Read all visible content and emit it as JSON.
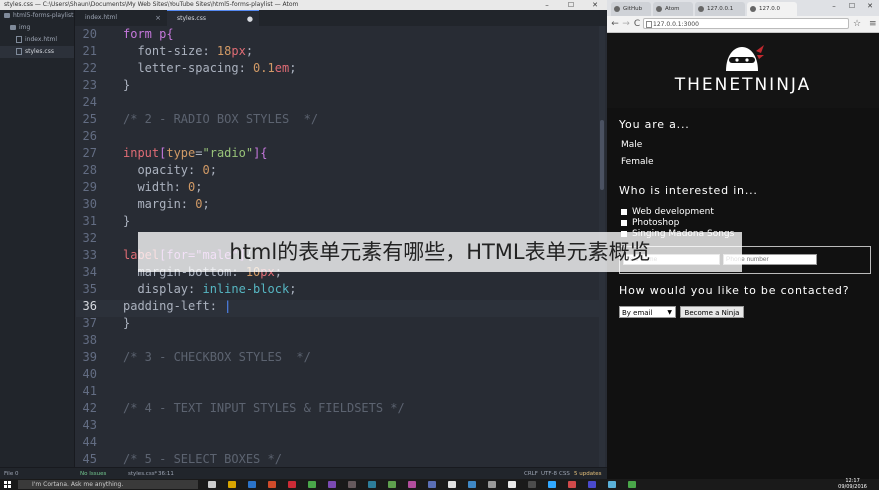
{
  "atom": {
    "title": "styles.css — C:\\Users\\Shaun\\Documents\\My Web Sites\\YouTube Sites\\html5-forms-playlist — Atom",
    "window_controls": [
      "–",
      "☐",
      "✕"
    ],
    "tree": {
      "root": "html5-forms-playlist",
      "items": [
        {
          "label": "img",
          "type": "folder"
        },
        {
          "label": "index.html",
          "type": "file"
        },
        {
          "label": "styles.css",
          "type": "file",
          "selected": true
        }
      ]
    },
    "tabs": [
      {
        "label": "index.html",
        "active": false
      },
      {
        "label": "styles.css",
        "active": true
      }
    ],
    "lines": [
      {
        "n": "20",
        "tokens": [
          [
            "form p{",
            "#c678dd"
          ]
        ]
      },
      {
        "n": "21",
        "tokens": [
          [
            "  font-size: ",
            "#abb2bf"
          ],
          [
            "18",
            "#d19a66"
          ],
          [
            "px",
            "#e06c75"
          ],
          [
            ";",
            "#abb2bf"
          ]
        ]
      },
      {
        "n": "22",
        "tokens": [
          [
            "  letter-spacing: ",
            "#abb2bf"
          ],
          [
            "0.1",
            "#d19a66"
          ],
          [
            "em",
            "#e06c75"
          ],
          [
            ";",
            "#abb2bf"
          ]
        ]
      },
      {
        "n": "23",
        "tokens": [
          [
            "}",
            "#abb2bf"
          ]
        ]
      },
      {
        "n": "24",
        "tokens": []
      },
      {
        "n": "25",
        "tokens": [
          [
            "/* 2 - RADIO BOX STYLES  */",
            "#5c6370"
          ]
        ]
      },
      {
        "n": "26",
        "tokens": []
      },
      {
        "n": "27",
        "tokens": [
          [
            "input",
            "#e06c75"
          ],
          [
            "[",
            "#c678dd"
          ],
          [
            "type",
            "#d19a66"
          ],
          [
            "=",
            "#abb2bf"
          ],
          [
            "\"radio\"",
            "#98c379"
          ],
          [
            "]{",
            "#c678dd"
          ]
        ]
      },
      {
        "n": "28",
        "tokens": [
          [
            "  opacity: ",
            "#abb2bf"
          ],
          [
            "0",
            "#d19a66"
          ],
          [
            ";",
            "#abb2bf"
          ]
        ]
      },
      {
        "n": "29",
        "tokens": [
          [
            "  width: ",
            "#abb2bf"
          ],
          [
            "0",
            "#d19a66"
          ],
          [
            ";",
            "#abb2bf"
          ]
        ]
      },
      {
        "n": "30",
        "tokens": [
          [
            "  margin: ",
            "#abb2bf"
          ],
          [
            "0",
            "#d19a66"
          ],
          [
            ";",
            "#abb2bf"
          ]
        ]
      },
      {
        "n": "31",
        "tokens": [
          [
            "}",
            "#abb2bf"
          ]
        ]
      },
      {
        "n": "32",
        "tokens": []
      },
      {
        "n": "33",
        "tokens": [
          [
            "label",
            "#e06c75"
          ],
          [
            "[for=\"male\"]",
            "#c678dd"
          ],
          [
            "{",
            "#abb2bf"
          ]
        ]
      },
      {
        "n": "34",
        "tokens": [
          [
            "  margin-bottom: ",
            "#abb2bf"
          ],
          [
            "10",
            "#d19a66"
          ],
          [
            "px",
            "#e06c75"
          ],
          [
            ";",
            "#abb2bf"
          ]
        ]
      },
      {
        "n": "35",
        "tokens": [
          [
            "  display: ",
            "#abb2bf"
          ],
          [
            "inline-block",
            "#56b6c2"
          ],
          [
            ";",
            "#abb2bf"
          ]
        ]
      },
      {
        "n": "36",
        "tokens": [
          [
            "padding-left: ",
            "#abb2bf"
          ],
          [
            "|",
            "#528bff"
          ]
        ],
        "current": true
      },
      {
        "n": "37",
        "tokens": [
          [
            "}",
            "#abb2bf"
          ]
        ]
      },
      {
        "n": "38",
        "tokens": []
      },
      {
        "n": "39",
        "tokens": [
          [
            "/* 3 - CHECKBOX STYLES  */",
            "#5c6370"
          ]
        ]
      },
      {
        "n": "40",
        "tokens": []
      },
      {
        "n": "41",
        "tokens": []
      },
      {
        "n": "42",
        "tokens": [
          [
            "/* 4 - TEXT INPUT STYLES & FIELDSETS */",
            "#5c6370"
          ]
        ]
      },
      {
        "n": "43",
        "tokens": []
      },
      {
        "n": "44",
        "tokens": []
      },
      {
        "n": "45",
        "tokens": [
          [
            "/* 5 - SELECT BOXES */",
            "#5c6370"
          ]
        ]
      }
    ],
    "status": {
      "left_file": "File 0",
      "issues": "No Issues",
      "path": "styles.css*",
      "pos": "36:11",
      "eol": "CRLF",
      "enc": "UTF-8",
      "grammar": "CSS",
      "updates": "5 updates"
    }
  },
  "chrome": {
    "tabs": [
      {
        "label": "GitHub",
        "active": false
      },
      {
        "label": "Atom",
        "active": false
      },
      {
        "label": "127.0.0.1",
        "active": false
      },
      {
        "label": "127.0.0",
        "active": true
      }
    ],
    "window_controls": [
      "–",
      "☐",
      "✕"
    ],
    "nav": {
      "back": "←",
      "forward": "→",
      "reload": "C"
    },
    "url": "127.0.0.1:3000",
    "page": {
      "logo": "THENETNINJA",
      "you_are": "You are a...",
      "genders": [
        "Male",
        "Female"
      ],
      "interests_heading": "Who is interested in...",
      "interests": [
        "Web development",
        "Photoshop",
        "Singing Madona Songs"
      ],
      "name_placeholder": "Your name",
      "phone_placeholder": "Phone number",
      "contact_heading": "How would you like to be contacted?",
      "select_value": "By email",
      "submit_label": "Become a Ninja"
    }
  },
  "overlay": {
    "text": "html的表单元素有哪些，HTML表单元素概览"
  },
  "taskbar": {
    "cortana": "I'm Cortana. Ask me anything.",
    "time": "12:17",
    "date": "09/09/2016"
  },
  "colors": {
    "editor_bg": "#282c34",
    "sidebar_bg": "#21252b",
    "accent": "#568af2",
    "browser_bg": "#111111"
  }
}
